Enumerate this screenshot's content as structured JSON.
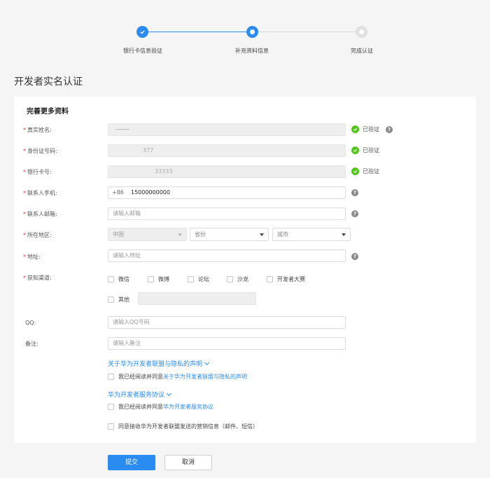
{
  "stepper": {
    "steps": [
      {
        "label": "银行卡信息验证",
        "state": "done"
      },
      {
        "label": "补充资料信息",
        "state": "active"
      },
      {
        "label": "完成认证",
        "state": "pending"
      }
    ]
  },
  "page_title": "开发者实名认证",
  "section_title": "完善更多资料",
  "fields": {
    "real_name": {
      "label": "真实姓名:",
      "value": "",
      "status": "已验证"
    },
    "id_number": {
      "label": "身份证号码:",
      "value": "377",
      "status": "已验证"
    },
    "bank_card": {
      "label": "银行卡号:",
      "value": "33333",
      "status": "已验证"
    },
    "phone": {
      "label": "联系人手机:",
      "prefix": "+86",
      "value": "15000000000"
    },
    "email": {
      "label": "联系人邮箱:",
      "placeholder": "请输入邮箱"
    },
    "region": {
      "label": "所在地区:",
      "country": "中国",
      "province": "省份",
      "city": "城市"
    },
    "address": {
      "label": "地址:",
      "placeholder": "请输入地址"
    },
    "channel": {
      "label": "获知渠道:",
      "options": [
        "微信",
        "微博",
        "论坛",
        "沙龙",
        "开发者大赛"
      ],
      "other_label": "其他"
    },
    "qq": {
      "label": "QQ:",
      "placeholder": "请输入QQ号码"
    },
    "remark": {
      "label": "备注:",
      "placeholder": "请输入备注"
    }
  },
  "agreements": {
    "privacy_toggle": "关于华为开发者联盟与隐私的声明",
    "privacy_prefix": "我已经阅读并同意",
    "privacy_link": "关于华为开发者联盟与隐私的声明",
    "service_toggle": "华为开发者服务协议",
    "service_prefix": "我已经阅读并同意",
    "service_link": "华为开发者服务协议",
    "marketing": "同意接收华为开发者联盟发送的营销信息（邮件、短信）"
  },
  "buttons": {
    "submit": "提交",
    "cancel": "取消"
  },
  "help_glyph": "?",
  "colors": {
    "primary": "#2a8cf0",
    "success": "#52c41a",
    "required": "#ee3333"
  }
}
